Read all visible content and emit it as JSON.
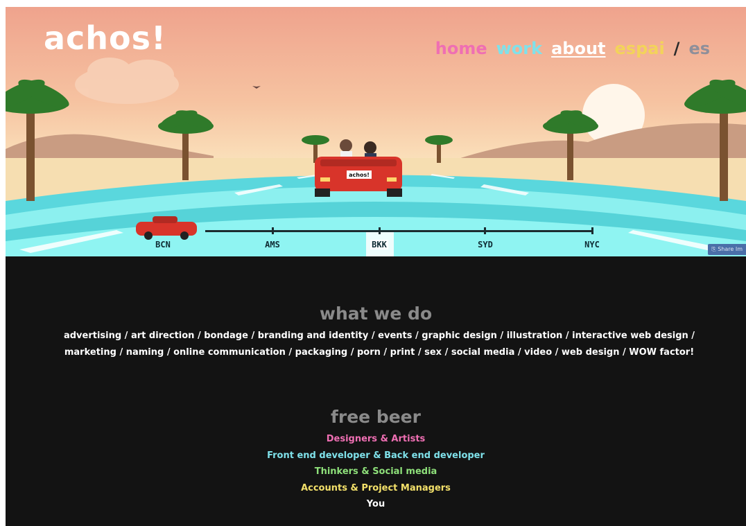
{
  "brand": {
    "logo": "achos!"
  },
  "nav": {
    "items": [
      {
        "label": "home",
        "color": "#ef6fb3"
      },
      {
        "label": "work",
        "color": "#7fe1ea"
      },
      {
        "label": "about",
        "color": "#ffffff"
      },
      {
        "label": "espai",
        "color": "#f3d35a"
      },
      {
        "label": "/",
        "color": "#2a2a2a"
      },
      {
        "label": "es",
        "color": "#8f8f9a"
      }
    ]
  },
  "hero": {
    "car_plate": "achos!",
    "cities": [
      "BCN",
      "AMS",
      "BKK",
      "SYD",
      "NYC"
    ],
    "active_city": "BKK",
    "share_label": "Share Im"
  },
  "what_we_do": {
    "title": "what we do",
    "services_line1": "advertising / art direction / bondage / branding and identity / events / graphic design / illustration / interactive web design /",
    "services_line2": "marketing / naming / online communication / packaging / porn / print / sex / social media / video / web design / WOW factor!"
  },
  "free_beer": {
    "title": "free beer",
    "roles": [
      {
        "label": "Designers & Artists",
        "color": "#ef6fb3"
      },
      {
        "label": "Front end developer & Back end developer",
        "color": "#7fe1ea"
      },
      {
        "label": "Thinkers & Social media",
        "color": "#8ee07a"
      },
      {
        "label": "Accounts & Project Managers",
        "color": "#f3e06a"
      },
      {
        "label": "You",
        "color": "#ffffff"
      }
    ]
  }
}
